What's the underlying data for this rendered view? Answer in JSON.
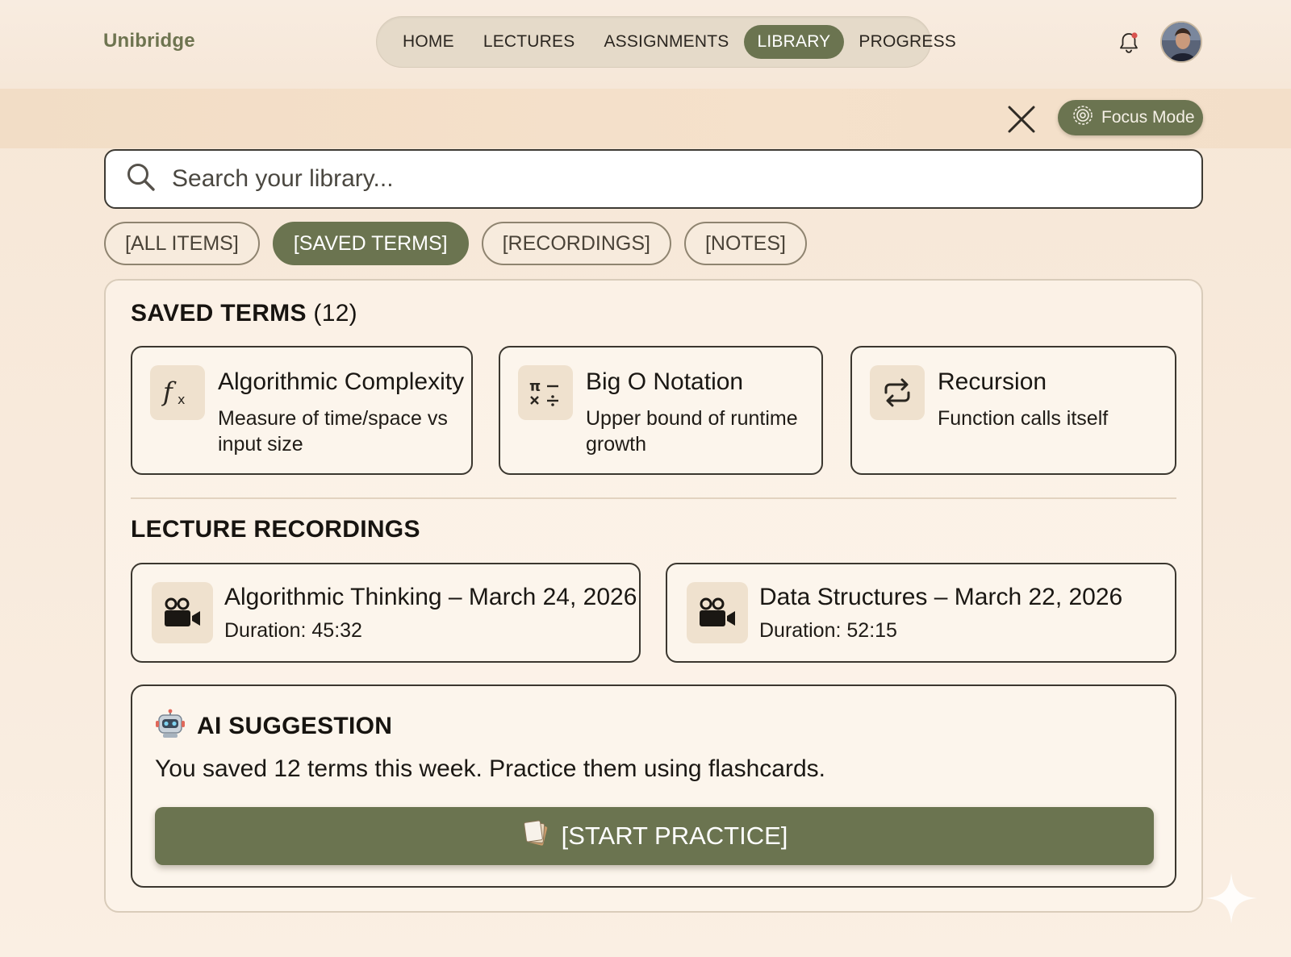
{
  "app": {
    "brand": "Unibridge"
  },
  "nav": {
    "items": [
      {
        "label": "HOME",
        "active": false
      },
      {
        "label": "LECTURES",
        "active": false
      },
      {
        "label": "ASSIGNMENTS",
        "active": false
      },
      {
        "label": "LIBRARY",
        "active": true
      },
      {
        "label": "PROGRESS",
        "active": false
      }
    ]
  },
  "header": {
    "notification_icon": "bell-icon",
    "has_unread": true,
    "unread_color": "#d9534f",
    "avatar_icon": "avatar"
  },
  "toolbar": {
    "close_icon": "close-icon",
    "focus_label": "Focus Mode",
    "focus_icon": "target-icon"
  },
  "search": {
    "placeholder": "Search your library...",
    "value": ""
  },
  "filters": [
    {
      "label": "[ALL ITEMS]",
      "active": false
    },
    {
      "label": "[SAVED TERMS]",
      "active": true
    },
    {
      "label": "[RECORDINGS]",
      "active": false
    },
    {
      "label": "[NOTES]",
      "active": false
    }
  ],
  "saved_terms": {
    "title": "SAVED TERMS",
    "count": "(12)",
    "items": [
      {
        "title": "Algorithmic Complexity",
        "desc": "Measure of time/space vs input size",
        "icon": "function-icon"
      },
      {
        "title": "Big O Notation",
        "desc": "Upper bound of runtime growth",
        "icon": "math-operators-icon"
      },
      {
        "title": "Recursion",
        "desc": "Function calls itself",
        "icon": "repeat-icon"
      }
    ]
  },
  "recordings": {
    "title": "LECTURE RECORDINGS",
    "items": [
      {
        "title": "Algorithmic Thinking – March 24, 2026",
        "duration": "Duration: 45:32",
        "icon": "video-camera-icon"
      },
      {
        "title": "Data Structures – March 22, 2026",
        "duration": "Duration: 52:15",
        "icon": "video-camera-icon"
      }
    ]
  },
  "ai": {
    "title": "AI SUGGESTION",
    "icon": "robot-icon",
    "message": "You saved 12 terms this week. Practice them using flashcards.",
    "button_label": "[START PRACTICE]",
    "button_icon": "flashcards-icon"
  },
  "colors": {
    "accent": "#6b7450",
    "brand": "#6e7450",
    "card_border": "#3b372f",
    "background": "#f8eadc"
  }
}
